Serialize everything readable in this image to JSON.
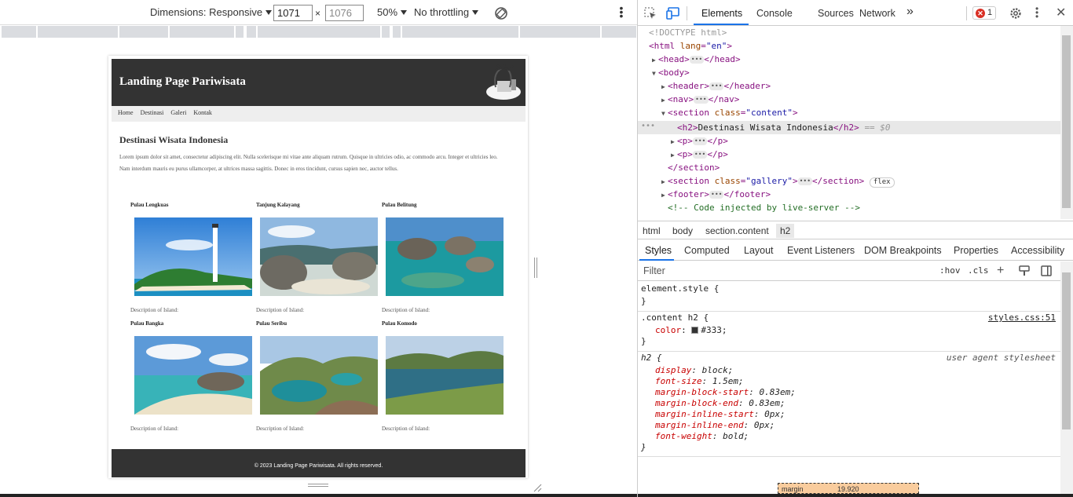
{
  "device_toolbar": {
    "dimensions_label": "Dimensions: Responsive",
    "width_value": "1071",
    "height_value": "1076",
    "times": "×",
    "zoom": "50%",
    "throttling": "No throttling"
  },
  "page": {
    "title": "Landing Page Pariwisata",
    "nav": [
      "Home",
      "Destinasi",
      "Galeri",
      "Kontak"
    ],
    "heading": "Destinasi Wisata Indonesia",
    "paragraph1": "Lorem ipsum dolor sit amet, consectetur adipiscing elit. Nulla scelerisque mi vitae ante aliquam rutrum. Quisque in ultricies odio, ac commodo arcu. Integer et ultricies leo.",
    "paragraph2": "Nam interdum mauris eu purus ullamcorper, at ultrices massa sagittis. Donec in eros tincidunt, cursus sapien nec, auctor tellus.",
    "gallery": [
      {
        "title": "Pulau Lengkuas",
        "desc": "Description of Island:"
      },
      {
        "title": "Tanjung Kalayang",
        "desc": "Description of Island:"
      },
      {
        "title": "Pulau Belitung",
        "desc": "Description of Island:"
      },
      {
        "title": "Pulau Bangka",
        "desc": "Description of Island:"
      },
      {
        "title": "Pulau Seribu",
        "desc": "Description of Island:"
      },
      {
        "title": "Pulau Komodo",
        "desc": "Description of Island:"
      }
    ],
    "footer": "© 2023 Landing Page Pariwisata. All rights reserved."
  },
  "devtools": {
    "tabs": [
      "Elements",
      "Console",
      "Sources",
      "Network"
    ],
    "more_tabs": "»",
    "error_count": "1",
    "dom": {
      "doctype": "<!DOCTYPE html>",
      "html_open": "<html",
      "html_lang_attr": "lang",
      "html_lang_val": "\"en\"",
      "head": "head",
      "body": "body",
      "header": "header",
      "nav": "nav",
      "section": "section",
      "section_class_attr": "class",
      "section_class_val": "\"content\"",
      "h2_text": "Destinasi Wisata Indonesia",
      "h2_eq": "== $0",
      "p": "p",
      "section_end": "</section>",
      "gallery_class_val": "\"gallery\"",
      "flex_badge": "flex",
      "footer": "footer",
      "comment": "<!-- Code injected by live-server -->"
    },
    "breadcrumb": [
      "html",
      "body",
      "section.content",
      "h2"
    ],
    "style_tabs": [
      "Styles",
      "Computed",
      "Layout",
      "Event Listeners",
      "DOM Breakpoints",
      "Properties",
      "Accessibility"
    ],
    "filter_placeholder": "Filter",
    "hov": ":hov",
    "cls": ".cls",
    "rules": {
      "element_style": "element.style {",
      "close": "}",
      "content_h2": ".content h2 {",
      "content_src": "styles.css:51",
      "color_prop": "color",
      "color_val": "#333;",
      "h2_sel": "h2 {",
      "ua_label": "user agent stylesheet",
      "ua_props": [
        {
          "p": "display",
          "v": "block;"
        },
        {
          "p": "font-size",
          "v": "1.5em;"
        },
        {
          "p": "margin-block-start",
          "v": "0.83em;"
        },
        {
          "p": "margin-block-end",
          "v": "0.83em;"
        },
        {
          "p": "margin-inline-start",
          "v": "0px;"
        },
        {
          "p": "margin-inline-end",
          "v": "0px;"
        },
        {
          "p": "font-weight",
          "v": "bold;"
        }
      ]
    },
    "boxmodel_label": "margin",
    "boxmodel_value": "19.920"
  },
  "colors": {
    "header_bg": "#333333",
    "accent": "#1a73e8",
    "error": "#d93025"
  }
}
